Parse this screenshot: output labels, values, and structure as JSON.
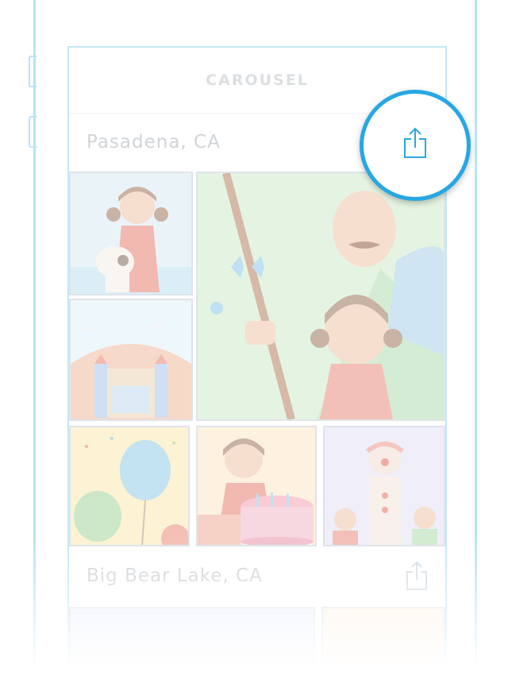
{
  "nav": {
    "title": "CAROUSEL"
  },
  "sections": [
    {
      "title": "Pasadena, CA"
    },
    {
      "title": "Big Bear Lake, CA"
    }
  ],
  "icons": {
    "share": "share-icon"
  },
  "colors": {
    "accent": "#27a7e3",
    "outline": "#b9e3f7",
    "muted_text": "#d0d4d8"
  }
}
